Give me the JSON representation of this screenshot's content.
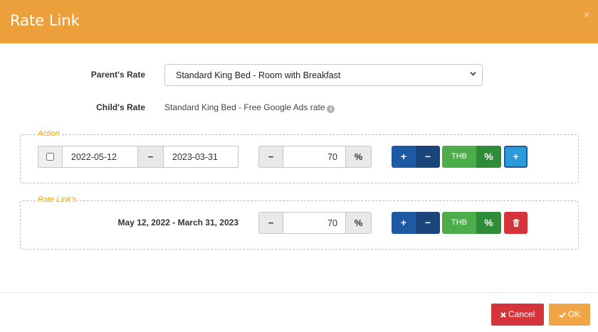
{
  "modal": {
    "title": "Rate Link",
    "close_label": "×"
  },
  "parent_rate": {
    "label": "Parent's Rate",
    "selected": "Standard King Bed - Room with Breakfast"
  },
  "child_rate": {
    "label": "Child's Rate",
    "value": "Standard King Bed - Free Google Ads rate",
    "info_glyph": "i"
  },
  "action": {
    "legend": "Action",
    "checkbox_checked": false,
    "start_date": "2022-05-12",
    "date_separator": "−",
    "end_date": "2023-03-31",
    "minus_label": "−",
    "amount": "70",
    "percent_label": "%",
    "plus_button": "+",
    "minus_button": "−",
    "currency_button": "THB",
    "percent_button": "%",
    "add_button": "+"
  },
  "rate_links": {
    "legend": "Rate Link's",
    "items": [
      {
        "period": "May 12, 2022 - March 31, 2023",
        "minus_label": "−",
        "amount": "70",
        "percent_label": "%",
        "plus_button": "+",
        "minus_button": "−",
        "currency_button": "THB",
        "percent_button": "%"
      }
    ]
  },
  "footer": {
    "cancel_label": "Cancel",
    "ok_label": "OK"
  },
  "colors": {
    "header": "#eca03c",
    "legend": "#e8a10c",
    "blue": "#1d5aa3",
    "green": "#4cad4a",
    "red": "#d5343b"
  },
  "icons": [
    "close-icon",
    "chevron-down-icon",
    "info-icon",
    "trash-icon",
    "times-icon",
    "check-icon"
  ]
}
